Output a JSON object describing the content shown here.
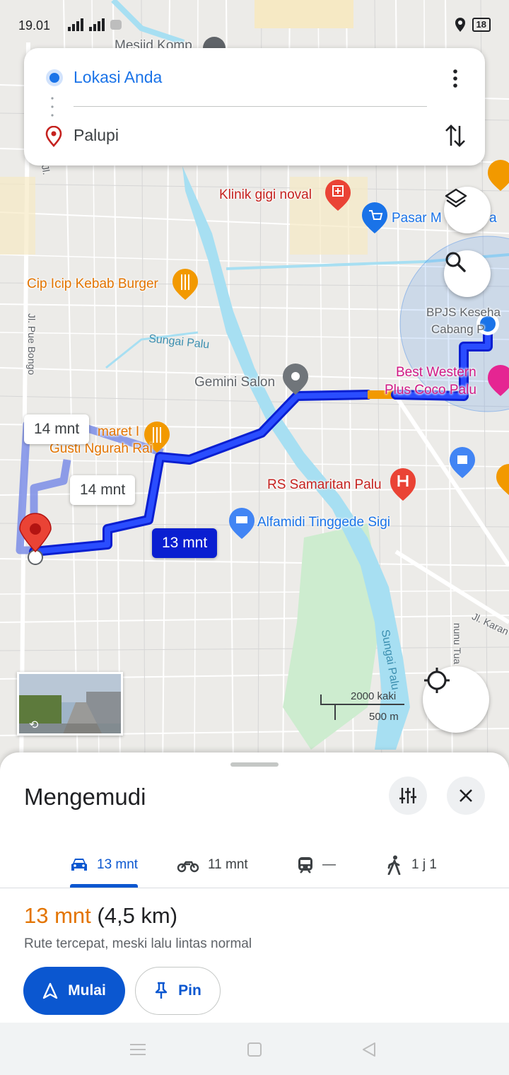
{
  "status_bar": {
    "time": "19.01",
    "signal": "⁴ᴳ",
    "battery": "18"
  },
  "directions": {
    "origin": "Lokasi Anda",
    "destination": "Palupi"
  },
  "map": {
    "pois": {
      "mesjid": "Mesjid Komp",
      "klinik": "Klinik gigi noval",
      "pasar": "Pasar M",
      "pasar_tail": "a",
      "cip_icip": "Cip Icip Kebab Burger",
      "bpjs": "BPJS Keseha",
      "cabang": "Cabang P",
      "best_western": "Best Western",
      "plus_coco": "Plus Coco Palu",
      "gemini": "Gemini Salon",
      "maret": "maret I",
      "gusti": "Gusti Ngurah Rai",
      "rs_samaritan": "RS Samaritan Palu",
      "alfamidi": "Alfamidi Tinggede Sigi"
    },
    "streets": {
      "pue_bongo": "Jl. Pue Bongo",
      "jl_top": "Jl.",
      "jl_karan": "Jl. Karan",
      "nunu_tua": "nunu Tua"
    },
    "water": {
      "sungai_palu_1": "Sungai Palu",
      "sungai_palu_2": "Sungai Palu"
    },
    "route_labels": {
      "alt1": "14 mnt",
      "alt2": "14 mnt",
      "main": "13 mnt"
    },
    "scale": {
      "feet": "2000 kaki",
      "meters": "500 m"
    }
  },
  "sheet": {
    "title": "Mengemudi",
    "modes": [
      {
        "icon": "car-icon",
        "label": "13 mnt"
      },
      {
        "icon": "motorbike-icon",
        "label": "11 mnt"
      },
      {
        "icon": "transit-icon",
        "label": "—"
      },
      {
        "icon": "walk-icon",
        "label": "1 j 1"
      }
    ],
    "eta_duration": "13 mnt",
    "eta_distance": "(4,5 km)",
    "description": "Rute tercepat, meski lalu lintas normal",
    "start_label": "Mulai",
    "pin_label": "Pin"
  },
  "colors": {
    "route": "#0a1fd1",
    "accent": "#0b57d0",
    "eta": "#e37400",
    "traffic": "#f29900"
  }
}
